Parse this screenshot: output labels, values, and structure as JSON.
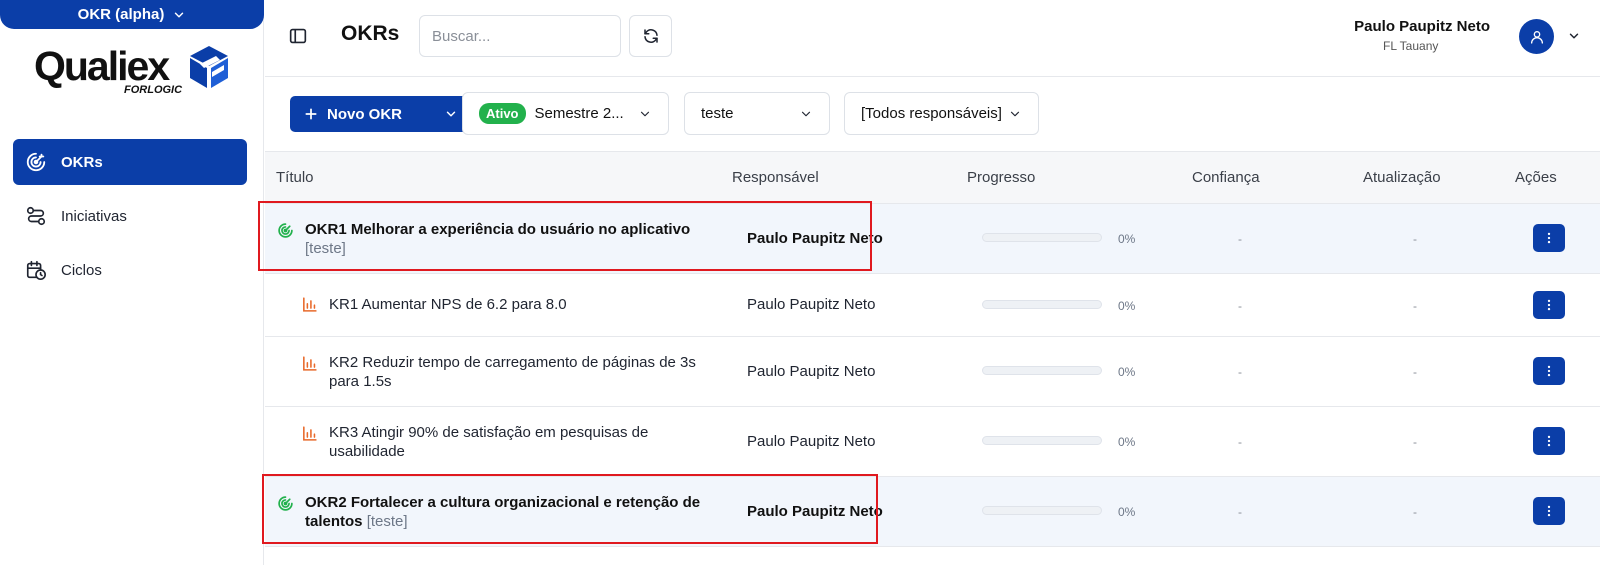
{
  "module": {
    "label": "OKR (alpha)"
  },
  "logo": {
    "word": "Qualiex",
    "sub": "FORLOGIC"
  },
  "sidebar": {
    "items": [
      {
        "label": "OKRs",
        "icon": "target-icon",
        "active": true
      },
      {
        "label": "Iniciativas",
        "icon": "workflow-icon",
        "active": false
      },
      {
        "label": "Ciclos",
        "icon": "calendar-clock-icon",
        "active": false
      }
    ]
  },
  "header": {
    "title": "OKRs",
    "search_placeholder": "Buscar...",
    "user_name": "Paulo Paupitz Neto",
    "user_org": "FL Tauany"
  },
  "filters": {
    "new_okr_label": "Novo OKR",
    "cycle_badge": "Ativo",
    "cycle_value": "Semestre 2...",
    "team_value": "teste",
    "responsible_value": "[Todos responsáveis]"
  },
  "table": {
    "columns": [
      "Título",
      "Responsável",
      "Progresso",
      "Confiança",
      "Atualização",
      "Ações"
    ],
    "rows": [
      {
        "type": "okr",
        "title": "OKR1 Melhorar a experiência do usuário no aplicativo",
        "tag": "[teste]",
        "responsible": "Paulo Paupitz Neto",
        "progress": 0,
        "progress_label": "0%",
        "confidence": "-",
        "updated": "-"
      },
      {
        "type": "kr",
        "title": "KR1 Aumentar NPS de 6.2 para 8.0",
        "responsible": "Paulo Paupitz Neto",
        "progress": 0,
        "progress_label": "0%",
        "confidence": "-",
        "updated": "-"
      },
      {
        "type": "kr",
        "title_line1": "KR2 Reduzir tempo de carregamento de páginas de 3s",
        "title_line2": "para 1.5s",
        "responsible": "Paulo Paupitz Neto",
        "progress": 0,
        "progress_label": "0%",
        "confidence": "-",
        "updated": "-"
      },
      {
        "type": "kr",
        "title_line1": "KR3 Atingir 90% de satisfação em pesquisas de",
        "title_line2": "usabilidade",
        "responsible": "Paulo Paupitz Neto",
        "progress": 0,
        "progress_label": "0%",
        "confidence": "-",
        "updated": "-"
      },
      {
        "type": "okr",
        "title_line1": "OKR2 Fortalecer a cultura organizacional e retenção de",
        "title_line2": "talentos",
        "tag": "[teste]",
        "responsible": "Paulo Paupitz Neto",
        "progress": 0,
        "progress_label": "0%",
        "confidence": "-",
        "updated": "-"
      }
    ]
  },
  "colors": {
    "primary": "#0b3ea8",
    "active_badge": "#22b14c",
    "okr_icon": "#22b14c",
    "kr_icon": "#e8692a",
    "highlight": "#e0191f"
  }
}
